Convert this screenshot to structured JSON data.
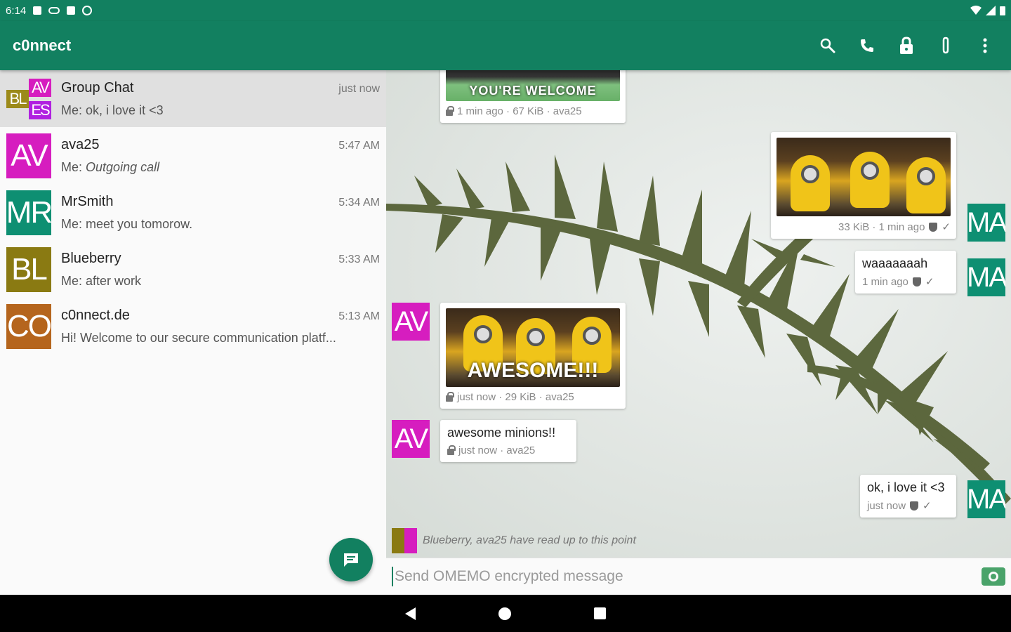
{
  "status_bar": {
    "time": "6:14"
  },
  "toolbar": {
    "title": "c0nnect",
    "actions": [
      "search-icon",
      "phone-icon",
      "lock-icon",
      "attach-icon",
      "more-vert-icon"
    ]
  },
  "conversations": [
    {
      "name": "Group Chat",
      "time": "just now",
      "sender": "Me:",
      "preview": "ok, i love it <3",
      "avatar": {
        "type": "group",
        "parts": [
          "BL",
          "AV",
          "ES"
        ]
      }
    },
    {
      "name": "ava25",
      "time": "5:47 AM",
      "sender": "Me:",
      "preview": "Outgoing call",
      "avatar": {
        "text": "AV",
        "color": "#d61dbf"
      }
    },
    {
      "name": "MrSmith",
      "time": "5:34 AM",
      "sender": "Me:",
      "preview": "meet you tomorow.",
      "avatar": {
        "text": "MR",
        "color": "#0e8f72"
      }
    },
    {
      "name": "Blueberry",
      "time": "5:33 AM",
      "sender": "Me:",
      "preview": "after work",
      "avatar": {
        "text": "BL",
        "color": "#8a7a12"
      }
    },
    {
      "name": "c0nnect.de",
      "time": "5:13 AM",
      "sender": "",
      "preview": "Hi! Welcome to our secure communication platf...",
      "avatar": {
        "text": "CO",
        "color": "#b5651d"
      }
    }
  ],
  "messages": {
    "welcome_image": {
      "caption": "YOU'RE WELCOME",
      "meta": "1 min ago · 67 KiB · ava25"
    },
    "sent_image": {
      "meta": "33 KiB · 1 min ago"
    },
    "sent_text_1": {
      "text": "waaaaaaah",
      "meta": "1 min ago"
    },
    "received_image": {
      "caption": "AWESOME!!!",
      "meta": "just now · 29 KiB · ava25"
    },
    "received_text": {
      "text": "awesome minions!!",
      "meta": "just now · ava25"
    },
    "sent_text_2": {
      "text": "ok, i love it <3",
      "meta": "just now"
    },
    "read_marker": "Blueberry, ava25 have read up to this point"
  },
  "avatars": {
    "self": "MA",
    "self_color": "#0e8f72",
    "ava": "AV",
    "ava_color": "#d61dbf"
  },
  "composer": {
    "placeholder": "Send OMEMO encrypted message"
  },
  "colors": {
    "primary": "#128060"
  }
}
